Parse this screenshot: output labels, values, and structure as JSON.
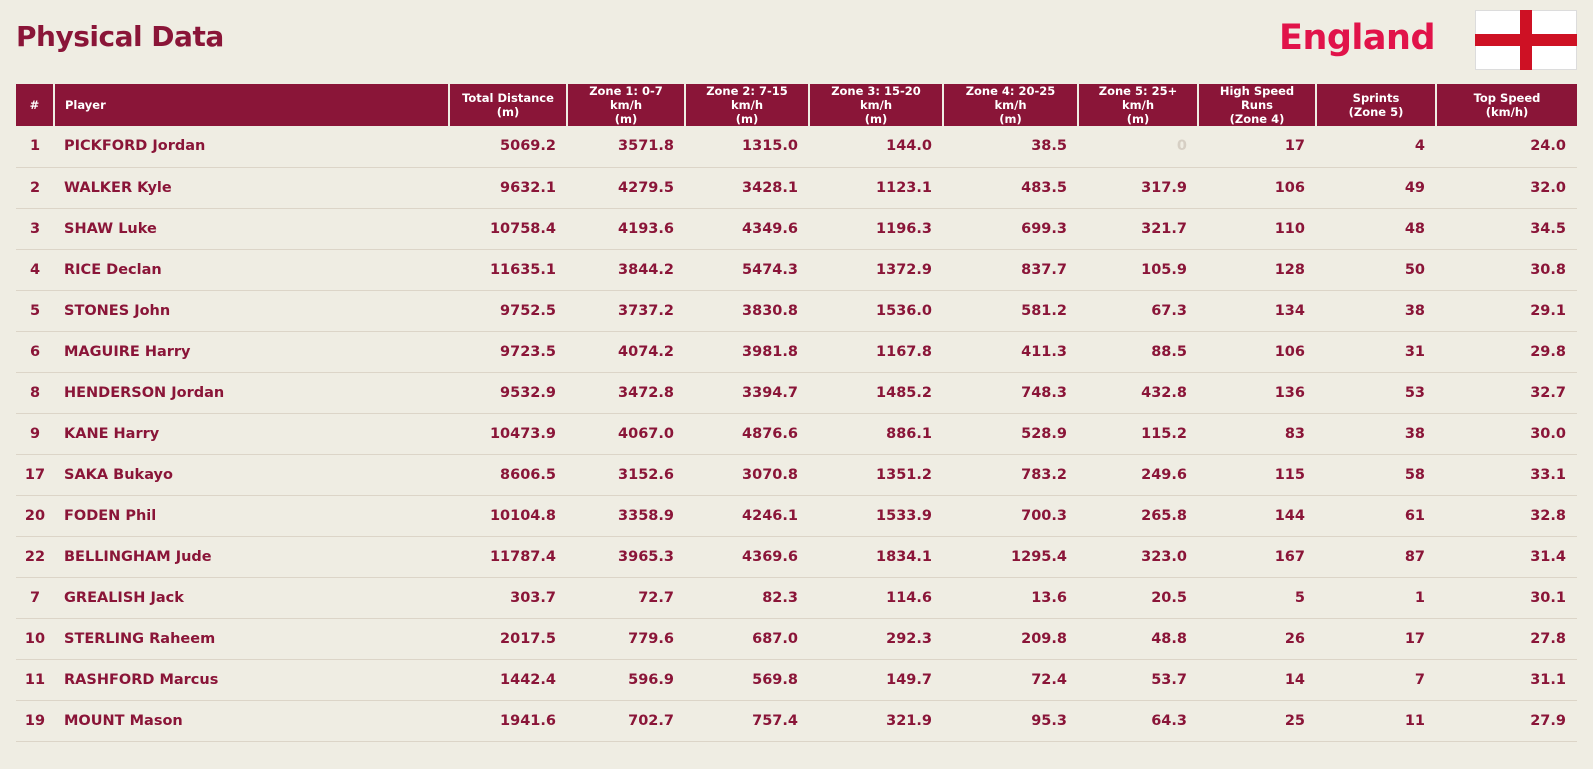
{
  "header": {
    "title": "Physical Data",
    "team": "England"
  },
  "colors": {
    "brand": "#8a1538",
    "accent": "#e1134a",
    "background": "#efede3"
  },
  "flag": {
    "icon": "england-flag-icon"
  },
  "table": {
    "columns": [
      {
        "line1": "#",
        "line2": ""
      },
      {
        "line1": "Player",
        "line2": ""
      },
      {
        "line1": "Total Distance",
        "line2": "(m)"
      },
      {
        "line1": "Zone 1: 0-7 km/h",
        "line2": "(m)"
      },
      {
        "line1": "Zone 2: 7-15 km/h",
        "line2": "(m)"
      },
      {
        "line1": "Zone 3: 15-20 km/h",
        "line2": "(m)"
      },
      {
        "line1": "Zone 4: 20-25 km/h",
        "line2": "(m)"
      },
      {
        "line1": "Zone 5: 25+ km/h",
        "line2": "(m)"
      },
      {
        "line1": "High Speed Runs",
        "line2": "(Zone 4)"
      },
      {
        "line1": "Sprints",
        "line2": "(Zone 5)"
      },
      {
        "line1": "Top Speed",
        "line2": "(km/h)"
      }
    ],
    "rows": [
      [
        "1",
        "PICKFORD Jordan",
        "5069.2",
        "3571.8",
        "1315.0",
        "144.0",
        "38.5",
        "0",
        "17",
        "4",
        "24.0"
      ],
      [
        "2",
        "WALKER Kyle",
        "9632.1",
        "4279.5",
        "3428.1",
        "1123.1",
        "483.5",
        "317.9",
        "106",
        "49",
        "32.0"
      ],
      [
        "3",
        "SHAW Luke",
        "10758.4",
        "4193.6",
        "4349.6",
        "1196.3",
        "699.3",
        "321.7",
        "110",
        "48",
        "34.5"
      ],
      [
        "4",
        "RICE Declan",
        "11635.1",
        "3844.2",
        "5474.3",
        "1372.9",
        "837.7",
        "105.9",
        "128",
        "50",
        "30.8"
      ],
      [
        "5",
        "STONES John",
        "9752.5",
        "3737.2",
        "3830.8",
        "1536.0",
        "581.2",
        "67.3",
        "134",
        "38",
        "29.1"
      ],
      [
        "6",
        "MAGUIRE Harry",
        "9723.5",
        "4074.2",
        "3981.8",
        "1167.8",
        "411.3",
        "88.5",
        "106",
        "31",
        "29.8"
      ],
      [
        "8",
        "HENDERSON Jordan",
        "9532.9",
        "3472.8",
        "3394.7",
        "1485.2",
        "748.3",
        "432.8",
        "136",
        "53",
        "32.7"
      ],
      [
        "9",
        "KANE Harry",
        "10473.9",
        "4067.0",
        "4876.6",
        "886.1",
        "528.9",
        "115.2",
        "83",
        "38",
        "30.0"
      ],
      [
        "17",
        "SAKA Bukayo",
        "8606.5",
        "3152.6",
        "3070.8",
        "1351.2",
        "783.2",
        "249.6",
        "115",
        "58",
        "33.1"
      ],
      [
        "20",
        "FODEN Phil",
        "10104.8",
        "3358.9",
        "4246.1",
        "1533.9",
        "700.3",
        "265.8",
        "144",
        "61",
        "32.8"
      ],
      [
        "22",
        "BELLINGHAM Jude",
        "11787.4",
        "3965.3",
        "4369.6",
        "1834.1",
        "1295.4",
        "323.0",
        "167",
        "87",
        "31.4"
      ],
      [
        "7",
        "GREALISH Jack",
        "303.7",
        "72.7",
        "82.3",
        "114.6",
        "13.6",
        "20.5",
        "5",
        "1",
        "30.1"
      ],
      [
        "10",
        "STERLING Raheem",
        "2017.5",
        "779.6",
        "687.0",
        "292.3",
        "209.8",
        "48.8",
        "26",
        "17",
        "27.8"
      ],
      [
        "11",
        "RASHFORD Marcus",
        "1442.4",
        "596.9",
        "569.8",
        "149.7",
        "72.4",
        "53.7",
        "14",
        "7",
        "31.1"
      ],
      [
        "19",
        "MOUNT Mason",
        "1941.6",
        "702.7",
        "757.4",
        "321.9",
        "95.3",
        "64.3",
        "25",
        "11",
        "27.9"
      ]
    ]
  }
}
